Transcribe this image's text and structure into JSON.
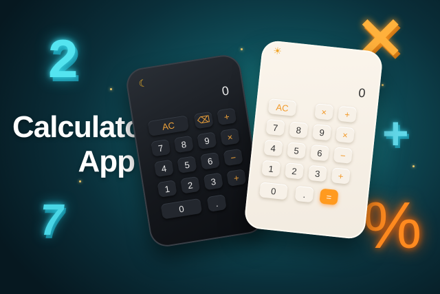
{
  "title": {
    "line1": "Calculator",
    "line2": "App"
  },
  "decorations": {
    "two": "2",
    "seven": "7",
    "times": "✕",
    "plus": "+",
    "percent": "%"
  },
  "dark_calculator": {
    "theme_icon": "☾",
    "display": "0",
    "keys": [
      "AC",
      "⌫",
      "+",
      "7",
      "8",
      "9",
      "×",
      "4",
      "5",
      "6",
      "−",
      "1",
      "2",
      "3",
      "+",
      "0",
      "."
    ]
  },
  "light_calculator": {
    "theme_icon": "☀",
    "display": "0",
    "keys": [
      "AC",
      "×",
      "+",
      "7",
      "8",
      "9",
      "×",
      "4",
      "5",
      "6",
      "−",
      "1",
      "2",
      "3",
      "+",
      "0",
      ".",
      "="
    ]
  },
  "colors": {
    "accent_orange": "#ff9a1f",
    "accent_cyan": "#54e4f0",
    "background": "#0f4f5a"
  }
}
